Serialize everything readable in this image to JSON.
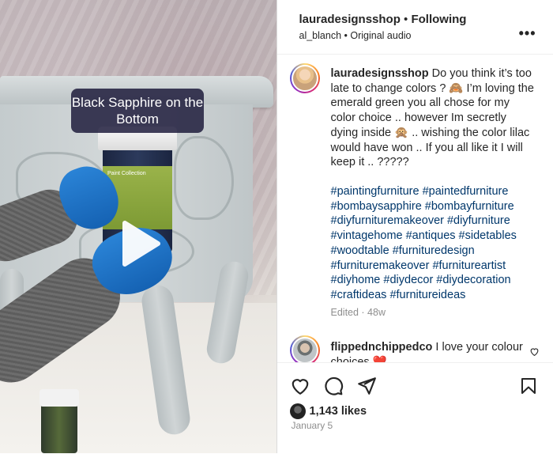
{
  "header": {
    "username": "lauradesignsshop",
    "separator": "•",
    "follow_status": "Following",
    "audio_user": "al_blanch",
    "audio_label": "Original audio",
    "more": "•••"
  },
  "media": {
    "overlay_caption": "Black Sapphire on the Bottom",
    "jar_label": "Paint Collection"
  },
  "caption": {
    "username": "lauradesignsshop",
    "text": "Do you think it’s too late to change colors ? 🙈 I’m loving the emerald green you all chose for my color choice .. however Im secretly dying inside 🙊 .. wishing the color lilac would have won .. If you all like it I will keep it .. ?????",
    "hashtags": "#paintingfurniture #paintedfurniture #bombaysapphire #bombayfurniture #diyfurnituremakeover #diyfurniture #vintagehome #antiques #sidetables #woodtable #furnituredesign #furnituremakeover #furnitureartist #diyhome #diydecor #diydecoration #craftideas #furnitureideas",
    "meta": "Edited · 48w"
  },
  "comment": {
    "username": "flippednchippedco",
    "text": "I love your colour choices ❤️"
  },
  "footer": {
    "likes": "1,143 likes",
    "date": "January 5"
  },
  "icons": {
    "like": "heart-icon",
    "comment": "comment-bubble-icon",
    "share": "paper-plane-icon",
    "save": "bookmark-icon"
  }
}
